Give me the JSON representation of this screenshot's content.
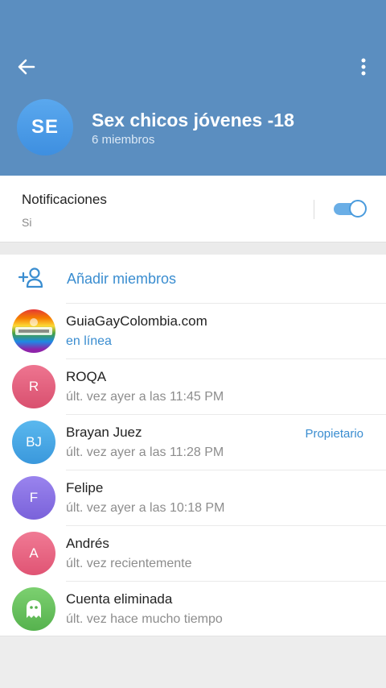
{
  "group": {
    "initials": "SE",
    "title": "Sex chicos jóvenes -18",
    "subtitle": "6 miembros"
  },
  "notifications": {
    "label": "Notificaciones",
    "value": "Si",
    "enabled": true
  },
  "add_members_label": "Añadir miembros",
  "members": [
    {
      "initials": "",
      "name": "GuiaGayColombia.com",
      "status": "en línea",
      "online": true,
      "role": "",
      "avatar_type": "rainbow-logo"
    },
    {
      "initials": "R",
      "name": "ROQA",
      "status": "últ. vez ayer a las 11:45 PM",
      "online": false,
      "role": "",
      "color": "#e0607c"
    },
    {
      "initials": "BJ",
      "name": "Brayan Juez",
      "status": "últ. vez ayer a las 11:28 PM",
      "online": false,
      "role": "Propietario",
      "color": "#4aa4e0"
    },
    {
      "initials": "F",
      "name": "Felipe",
      "status": "últ. vez ayer a las 10:18 PM",
      "online": false,
      "role": "",
      "color": "#8a72e0"
    },
    {
      "initials": "A",
      "name": "Andrés",
      "status": "últ. vez recientemente",
      "online": false,
      "role": "",
      "color": "#e9627e"
    },
    {
      "initials": "",
      "name": "Cuenta eliminada",
      "status": "últ. vez hace mucho tiempo",
      "online": false,
      "role": "",
      "avatar_type": "ghost",
      "color": "#6cc066"
    }
  ],
  "colors": {
    "header": "#5b8ec0",
    "accent": "#3a8dd0"
  }
}
